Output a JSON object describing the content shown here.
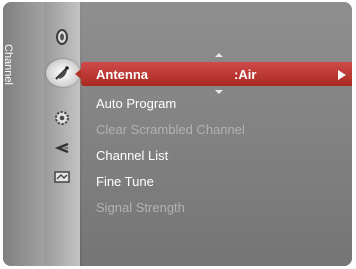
{
  "category_label": "Channel",
  "sidebar_icons": [
    {
      "name": "picture-icon"
    },
    {
      "name": "channel-icon",
      "selected": true
    },
    {
      "name": "setup-icon"
    },
    {
      "name": "input-icon"
    },
    {
      "name": "application-icon"
    }
  ],
  "menu": {
    "items": [
      {
        "label": "Antenna",
        "value": ":Air",
        "state": "selected"
      },
      {
        "label": "Auto Program",
        "state": "enabled"
      },
      {
        "label": "Clear Scrambled Channel",
        "state": "disabled"
      },
      {
        "label": "Channel List",
        "state": "enabled"
      },
      {
        "label": "Fine Tune",
        "state": "enabled"
      },
      {
        "label": "Signal Strength",
        "state": "disabled"
      }
    ]
  },
  "colors": {
    "highlight": "#b3322a",
    "panel": "#7a7a7a",
    "text": "#ffffff",
    "text_disabled": "#b2b2b2"
  }
}
